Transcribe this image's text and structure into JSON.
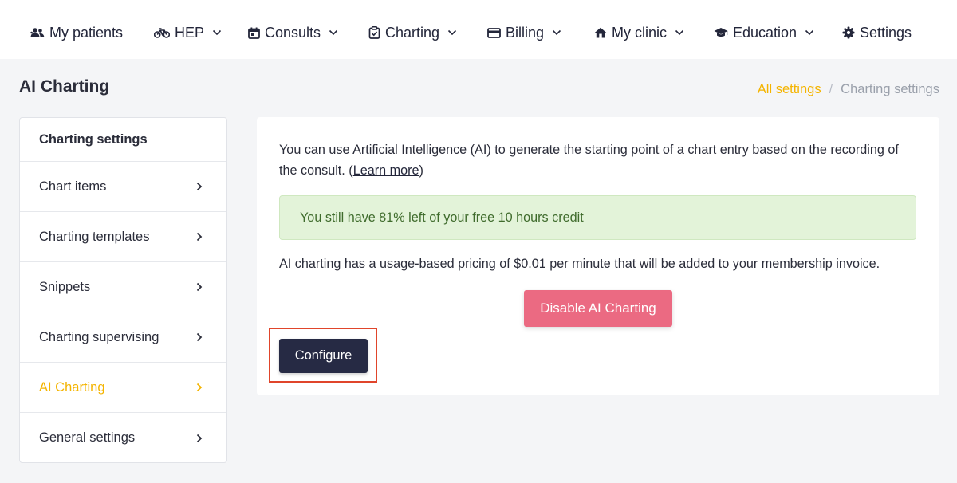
{
  "nav": {
    "items": [
      {
        "label": "My patients",
        "icon": "users-icon",
        "dropdown": false
      },
      {
        "label": "HEP",
        "icon": "bicycle-icon",
        "dropdown": true
      },
      {
        "label": "Consults",
        "icon": "calendar-icon",
        "dropdown": true
      },
      {
        "label": "Charting",
        "icon": "clipboard-icon",
        "dropdown": true
      },
      {
        "label": "Billing",
        "icon": "credit-card-icon",
        "dropdown": true
      },
      {
        "label": "My clinic",
        "icon": "house-icon",
        "dropdown": true
      },
      {
        "label": "Education",
        "icon": "graduation-cap-icon",
        "dropdown": true
      },
      {
        "label": "Settings",
        "icon": "gear-icon",
        "dropdown": false
      }
    ]
  },
  "page": {
    "title": "AI Charting"
  },
  "breadcrumb": {
    "link": "All settings",
    "separator": "/",
    "current": "Charting settings"
  },
  "sidebar": {
    "header": "Charting settings",
    "items": [
      {
        "label": "Chart items",
        "active": false
      },
      {
        "label": "Charting templates",
        "active": false
      },
      {
        "label": "Snippets",
        "active": false
      },
      {
        "label": "Charting supervising",
        "active": false
      },
      {
        "label": "AI Charting",
        "active": true
      },
      {
        "label": "General settings",
        "active": false
      }
    ]
  },
  "main": {
    "intro_text": "You can use Artificial Intelligence (AI) to generate the starting point of a chart entry based on the recording of the consult. (",
    "learn_more": "Learn more",
    "intro_close": ")",
    "credit_notice": "You still have 81% left of your free 10 hours credit",
    "pricing_text": "AI charting has a usage-based pricing of $0.01 per minute that will be added to your membership invoice.",
    "disable_button": "Disable AI Charting",
    "configure_button": "Configure"
  },
  "colors": {
    "accent": "#f4b400",
    "primary_dark": "#262a44",
    "danger": "#eb6a82",
    "success_bg": "#e3f3d9",
    "success_text": "#3f6b2c",
    "highlight": "#e0452b"
  }
}
